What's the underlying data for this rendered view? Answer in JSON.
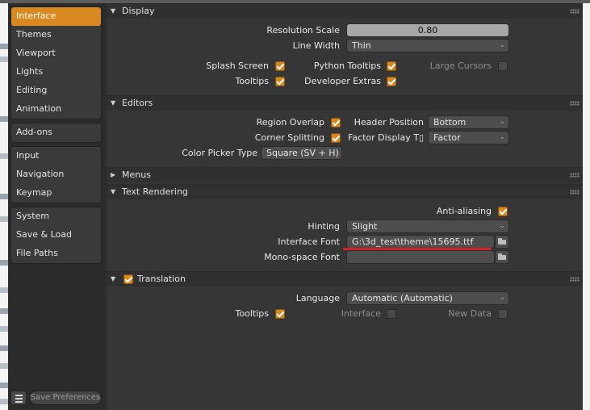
{
  "sidebar": {
    "groups": [
      [
        "Interface",
        "Themes",
        "Viewport",
        "Lights",
        "Editing",
        "Animation"
      ],
      [
        "Add-ons"
      ],
      [
        "Input",
        "Navigation",
        "Keymap"
      ],
      [
        "System",
        "Save & Load",
        "File Paths"
      ]
    ],
    "active": "Interface",
    "save_label": "Save Preferences"
  },
  "display": {
    "title": "Display",
    "resolution_label": "Resolution Scale",
    "resolution_value": "0.80",
    "line_width_label": "Line Width",
    "line_width_value": "Thin",
    "splash_label": "Splash Screen",
    "splash_checked": true,
    "python_tooltips_label": "Python Tooltips",
    "python_tooltips_checked": true,
    "large_cursors_label": "Large Cursors",
    "large_cursors_checked": false,
    "tooltips_label": "Tooltips",
    "tooltips_checked": true,
    "dev_extras_label": "Developer Extras",
    "dev_extras_checked": true
  },
  "editors": {
    "title": "Editors",
    "region_overlap_label": "Region Overlap",
    "region_overlap_checked": true,
    "header_position_label": "Header Position",
    "header_position_value": "Bottom",
    "corner_splitting_label": "Corner Splitting",
    "corner_splitting_checked": true,
    "factor_display_label": "Factor Display T▯",
    "factor_display_value": "Factor",
    "color_picker_label": "Color Picker Type",
    "color_picker_value": "Square (SV + H)"
  },
  "menus": {
    "title": "Menus"
  },
  "text_rendering": {
    "title": "Text Rendering",
    "antialiasing_label": "Anti-aliasing",
    "antialiasing_checked": true,
    "hinting_label": "Hinting",
    "hinting_value": "Slight",
    "interface_font_label": "Interface Font",
    "interface_font_value": "G:\\3d_test\\theme\\15695.ttf",
    "mono_font_label": "Mono-space Font",
    "mono_font_value": ""
  },
  "translation": {
    "title": "Translation",
    "enabled": true,
    "language_label": "Language",
    "language_value": "Automatic (Automatic)",
    "tooltips_label": "Tooltips",
    "tooltips_checked": true,
    "interface_label": "Interface",
    "interface_checked": false,
    "new_data_label": "New Data",
    "new_data_checked": false
  },
  "colors": {
    "accent": "#d9891f",
    "panel_bg": "#363636",
    "sidebar_bg": "#2b2b2b",
    "annotation": "#d42020"
  }
}
